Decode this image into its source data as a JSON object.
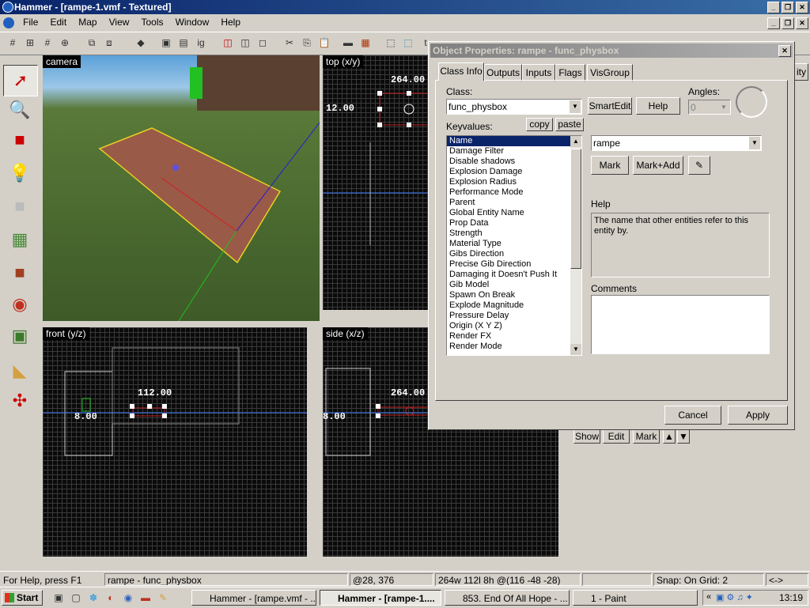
{
  "window": {
    "title": "Hammer - [rampe-1.vmf - Textured]"
  },
  "menu": [
    "File",
    "Edit",
    "Map",
    "View",
    "Tools",
    "Window",
    "Help"
  ],
  "viewports": {
    "camera": {
      "label": "camera"
    },
    "top": {
      "label": "top (x/y)",
      "dim_w": "264.00",
      "dim_h": "12.00"
    },
    "front": {
      "label": "front (y/z)",
      "dim_w": "112.00",
      "dim_h": "8.00"
    },
    "side": {
      "label": "side (x/z)",
      "dim_w": "264.00",
      "dim_h": "8.00"
    }
  },
  "dialog": {
    "title": "Object Properties: rampe - func_physbox",
    "tabs": [
      "Class Info",
      "Outputs",
      "Inputs",
      "Flags",
      "VisGroup"
    ],
    "class_label": "Class:",
    "class_value": "func_physbox",
    "smartedit": "SmartEdit",
    "help_button": "Help",
    "angles_label": "Angles:",
    "angles_value": "0",
    "keyvalues_label": "Keyvalues:",
    "copy": "copy",
    "paste": "paste",
    "keyvalues": [
      "Name",
      "Damage Filter",
      "Disable shadows",
      "Explosion Damage",
      "Explosion Radius",
      "Performance Mode",
      "Parent",
      "Global Entity Name",
      "Prop Data",
      "Strength",
      "Material Type",
      "Gibs Direction",
      "Precise Gib Direction",
      "Damaging it Doesn't Push It",
      "Gib Model",
      "Spawn On Break",
      "Explode Magnitude",
      "Pressure Delay",
      "Origin (X Y Z)",
      "Render FX",
      "Render Mode"
    ],
    "value": "rampe",
    "mark": "Mark",
    "mark_add": "Mark+Add",
    "help_label": "Help",
    "help_text": "The name that other entities refer to this entity by.",
    "comments_label": "Comments",
    "cancel": "Cancel",
    "apply": "Apply"
  },
  "behind": {
    "show": "Show",
    "edit": "Edit",
    "mark": "Mark",
    "ity": "ity"
  },
  "status": {
    "help": "For Help, press F1",
    "selection": "rampe - func_physbox",
    "coords": "@28, 376",
    "size": "264w 112l 8h @(116 -48 -28)",
    "snap": "Snap: On Grid: 2",
    "extra": "<->"
  },
  "taskbar": {
    "start": "Start",
    "tasks": [
      "Hammer - [rampe.vmf - ...",
      "Hammer - [rampe-1....",
      "853. End Of All Hope - ...",
      "1 - Paint"
    ],
    "clock": "13:19"
  },
  "colors": {
    "selection": "#0a246a",
    "titlebar": "#0a246a",
    "face": "#d4d0c8"
  }
}
